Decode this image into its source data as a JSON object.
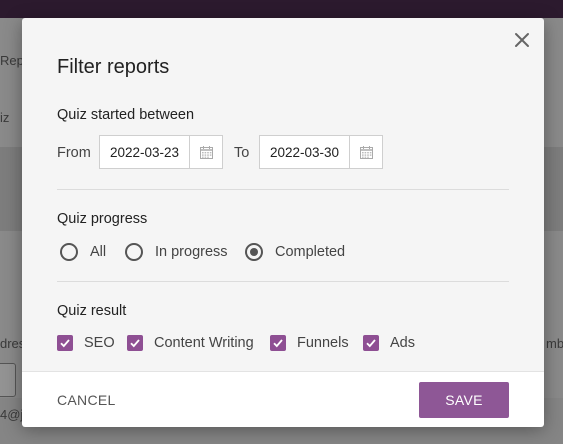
{
  "background": {
    "text_1": "Repo",
    "text_2": "iz",
    "text_3": "dres",
    "text_4": "mbe",
    "text_5": "4@j"
  },
  "dialog": {
    "title": "Filter reports",
    "close_icon": "close-icon",
    "dates": {
      "label": "Quiz started between",
      "from_label": "From",
      "from_value": "2022-03-23",
      "to_label": "To",
      "to_value": "2022-03-30",
      "calendar_icon": "calendar-icon"
    },
    "progress": {
      "label": "Quiz progress",
      "options": [
        "All",
        "In progress",
        "Completed"
      ],
      "selected": "Completed"
    },
    "result": {
      "label": "Quiz result",
      "options": [
        "SEO",
        "Content Writing",
        "Funnels",
        "Ads"
      ],
      "checked": [
        "SEO",
        "Content Writing",
        "Funnels",
        "Ads"
      ]
    },
    "footer": {
      "cancel_label": "CANCEL",
      "save_label": "SAVE"
    }
  },
  "colors": {
    "accent": "#8e5796",
    "checkbox": "#8e4f93",
    "topbar": "#2c1a2e"
  }
}
